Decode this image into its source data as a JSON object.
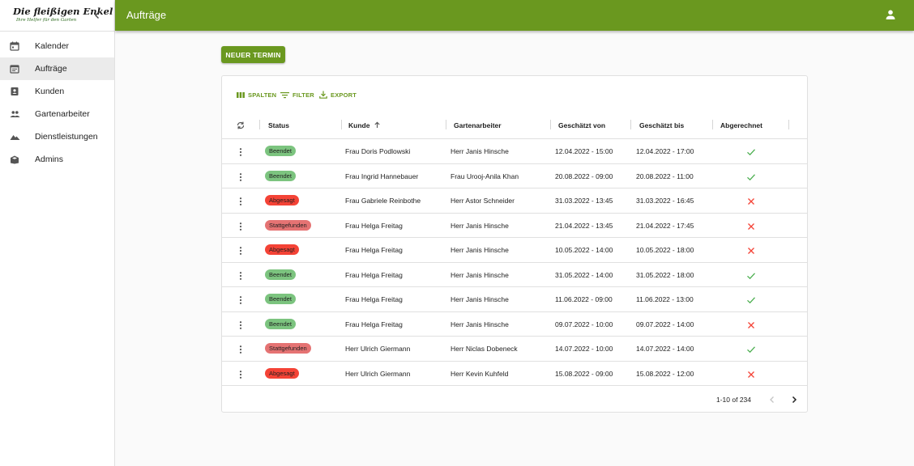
{
  "logo": {
    "title": "Die fleißigen Enkel",
    "subtitle": "Ihre Helfer für den Garten"
  },
  "sidebar": {
    "items": [
      {
        "label": "Kalender",
        "icon": "calendar-icon",
        "active": false
      },
      {
        "label": "Aufträge",
        "icon": "event-note-icon",
        "active": true
      },
      {
        "label": "Kunden",
        "icon": "contact-card-icon",
        "active": false
      },
      {
        "label": "Gartenarbeiter",
        "icon": "people-icon",
        "active": false
      },
      {
        "label": "Dienstleistungen",
        "icon": "landscape-icon",
        "active": false
      },
      {
        "label": "Admins",
        "icon": "admin-box-icon",
        "active": false
      }
    ]
  },
  "appbar": {
    "title": "Aufträge"
  },
  "actions": {
    "new_label": "NEUER TERMIN"
  },
  "toolbar": {
    "columns_label": "SPALTEN",
    "filter_label": "FILTER",
    "export_label": "EXPORT"
  },
  "table": {
    "columns": [
      "Status",
      "Kunde",
      "Gartenarbeiter",
      "Geschätzt von",
      "Geschätzt bis",
      "Abgerechnet"
    ],
    "sort": {
      "column": "Kunde",
      "direction": "asc"
    },
    "rows": [
      {
        "status": "Beendet",
        "customer": "Frau Doris Podlowski",
        "worker": "Herr Janis Hinsche",
        "from": "12.04.2022 - 15:00",
        "to": "12.04.2022 - 17:00",
        "billed": true
      },
      {
        "status": "Beendet",
        "customer": "Frau Ingrid Hannebauer",
        "worker": "Frau Urooj-Anila Khan",
        "from": "20.08.2022 - 09:00",
        "to": "20.08.2022 - 11:00",
        "billed": true
      },
      {
        "status": "Abgesagt",
        "customer": "Frau Gabriele Reinbothe",
        "worker": "Herr Astor Schneider",
        "from": "31.03.2022 - 13:45",
        "to": "31.03.2022 - 16:45",
        "billed": false
      },
      {
        "status": "Stattgefunden",
        "customer": "Frau Helga Freitag",
        "worker": "Herr Janis Hinsche",
        "from": "21.04.2022 - 13:45",
        "to": "21.04.2022 - 17:45",
        "billed": false
      },
      {
        "status": "Abgesagt",
        "customer": "Frau Helga Freitag",
        "worker": "Herr Janis Hinsche",
        "from": "10.05.2022 - 14:00",
        "to": "10.05.2022 - 18:00",
        "billed": false
      },
      {
        "status": "Beendet",
        "customer": "Frau Helga Freitag",
        "worker": "Herr Janis Hinsche",
        "from": "31.05.2022 - 14:00",
        "to": "31.05.2022 - 18:00",
        "billed": true
      },
      {
        "status": "Beendet",
        "customer": "Frau Helga Freitag",
        "worker": "Herr Janis Hinsche",
        "from": "11.06.2022 - 09:00",
        "to": "11.06.2022 - 13:00",
        "billed": true
      },
      {
        "status": "Beendet",
        "customer": "Frau Helga Freitag",
        "worker": "Herr Janis Hinsche",
        "from": "09.07.2022 - 10:00",
        "to": "09.07.2022 - 14:00",
        "billed": false
      },
      {
        "status": "Stattgefunden",
        "customer": "Herr Ulrich Giermann",
        "worker": "Herr Niclas Dobeneck",
        "from": "14.07.2022 - 10:00",
        "to": "14.07.2022 - 14:00",
        "billed": true
      },
      {
        "status": "Abgesagt",
        "customer": "Herr Ulrich Giermann",
        "worker": "Herr Kevin Kuhfeld",
        "from": "15.08.2022 - 09:00",
        "to": "15.08.2022 - 12:00",
        "billed": false
      }
    ]
  },
  "pagination": {
    "label": "1-10 of 234"
  },
  "colors": {
    "primary": "#6a981f",
    "status_Beendet": "#7cc47f",
    "status_Abgesagt": "#f44336",
    "status_Stattgefunden": "#e57373",
    "check": "#4caf50",
    "cross": "#f44336"
  }
}
